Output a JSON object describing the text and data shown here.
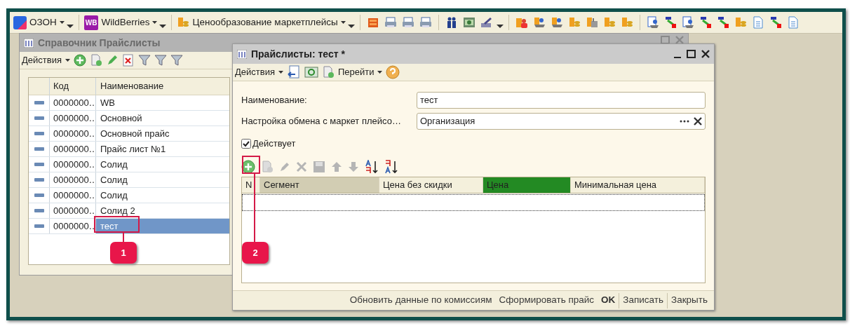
{
  "toolbar": {
    "menus": [
      {
        "label": "ОЗОН",
        "kind": "ozon"
      },
      {
        "label": "WildBerries",
        "kind": "wb",
        "logo_text": "WB"
      },
      {
        "label": "Ценообразование маркетплейсы",
        "kind": "coins"
      }
    ]
  },
  "list_window": {
    "title": "Справочник Прайслисты",
    "actions": "Действия",
    "columns": [
      "Код",
      "Наименование"
    ],
    "rows": [
      {
        "code": "0000000…",
        "name": "WB",
        "selected": false
      },
      {
        "code": "0000000…",
        "name": "Основной",
        "selected": false
      },
      {
        "code": "0000000…",
        "name": "Основной прайс",
        "selected": false
      },
      {
        "code": "0000000…",
        "name": "Прайс лист №1",
        "selected": false
      },
      {
        "code": "0000000…",
        "name": "Солид",
        "selected": false
      },
      {
        "code": "0000000…",
        "name": "Солид",
        "selected": false
      },
      {
        "code": "0000000…",
        "name": "Солид",
        "selected": false
      },
      {
        "code": "0000000…",
        "name": "Солид 2",
        "selected": false
      },
      {
        "code": "0000000…",
        "name": "тест",
        "selected": true
      }
    ]
  },
  "form_window": {
    "title": "Прайслисты: тест *",
    "actions": "Действия",
    "goto": "Перейти",
    "fields": [
      {
        "label": "Наименование:",
        "value": "тест",
        "kind": "text"
      },
      {
        "label": "Настройка обмена с маркет плейсо…",
        "value": "Организация",
        "kind": "select"
      }
    ],
    "checkbox": {
      "label": "Действует",
      "checked": true
    },
    "columns": [
      {
        "label": "N"
      },
      {
        "label": "Сегмент",
        "color": "#d2cdb3"
      },
      {
        "label": "Цена без скидки"
      },
      {
        "label": "Цена",
        "color": "#238a23"
      },
      {
        "label": "Минимальная цена"
      }
    ],
    "buttons": [
      {
        "label": "Обновить данные по комиссиям",
        "kind": "plain"
      },
      {
        "label": "Сформировать прайс",
        "kind": "plain"
      },
      {
        "label": "OK",
        "kind": "default"
      },
      {
        "label": "Записать",
        "kind": "plain"
      },
      {
        "label": "Закрыть",
        "kind": "plain"
      }
    ]
  },
  "callouts": [
    {
      "label": "1"
    },
    {
      "label": "2"
    }
  ]
}
